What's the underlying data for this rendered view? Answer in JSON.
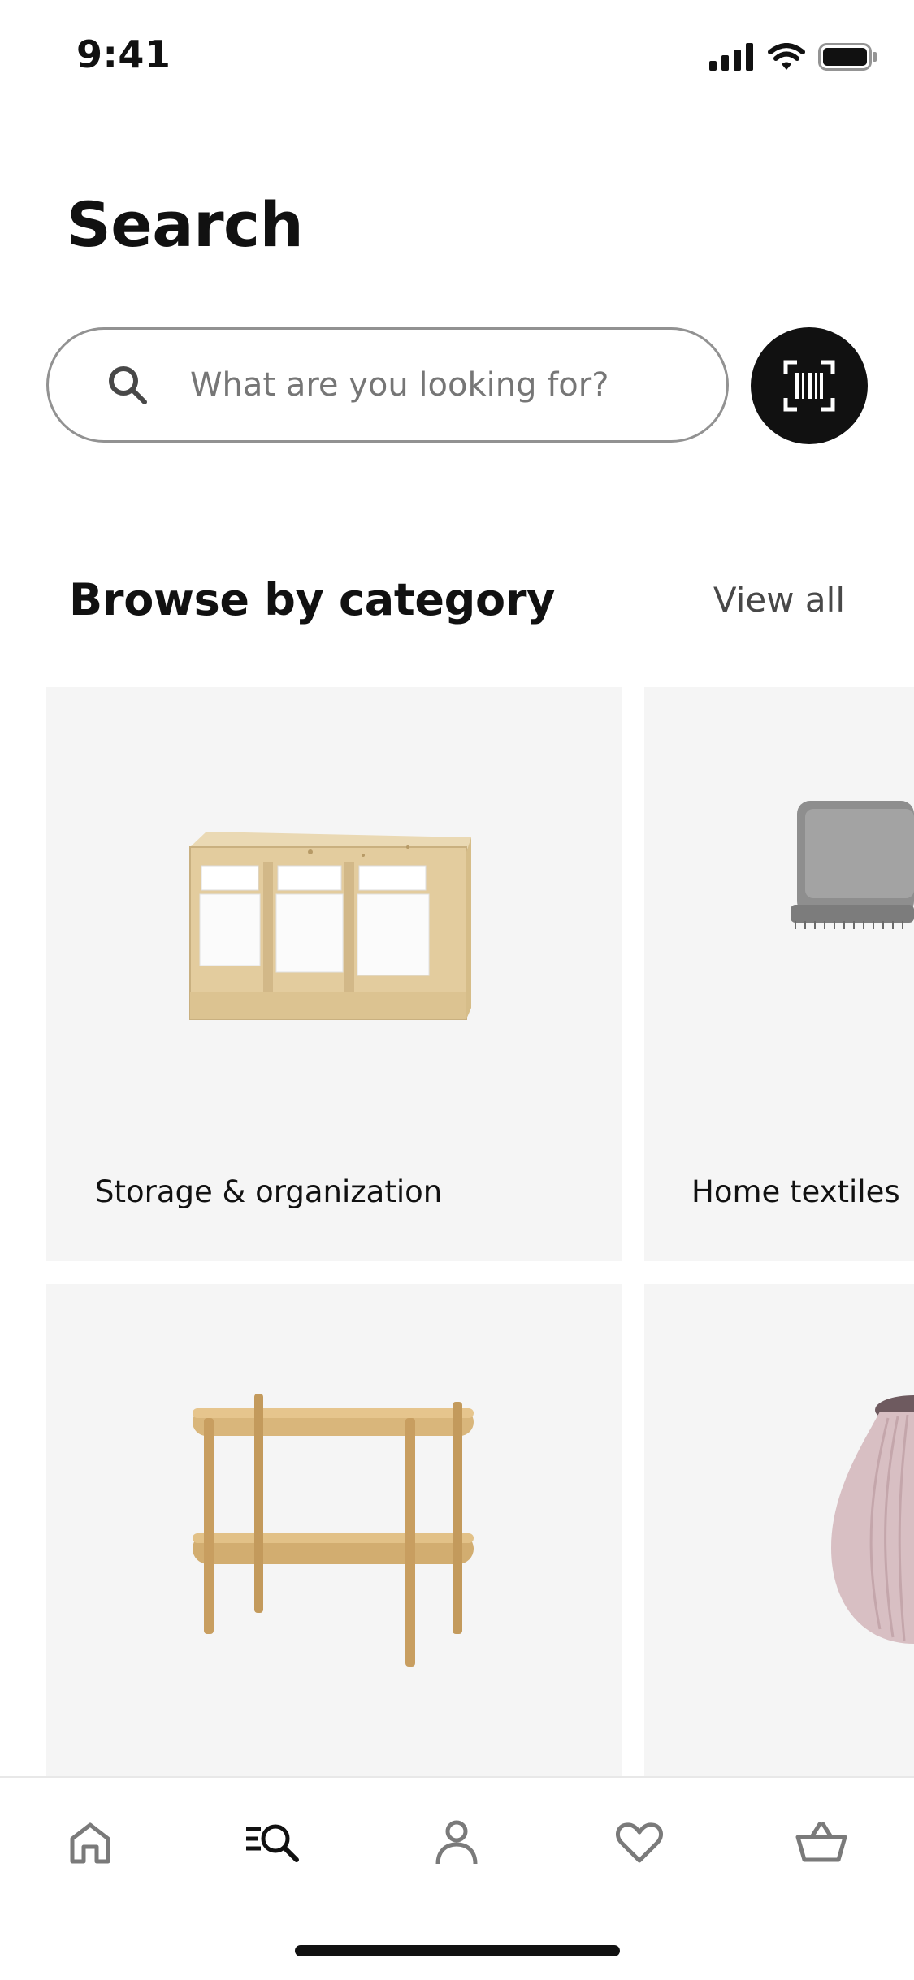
{
  "status_bar": {
    "time": "9:41"
  },
  "page": {
    "title": "Search"
  },
  "search": {
    "placeholder": "What are you looking for?"
  },
  "browse": {
    "title": "Browse by category",
    "view_all": "View all",
    "categories": [
      {
        "label": "Storage & organization",
        "image": "storage-shelf-image"
      },
      {
        "label": "Home textiles",
        "image": "grey-throw-image"
      },
      {
        "label": "",
        "image": "console-table-image"
      },
      {
        "label": "",
        "image": "pink-vase-image"
      }
    ]
  },
  "tabbar": {
    "items": [
      {
        "icon": "home-icon"
      },
      {
        "icon": "search-icon",
        "active": true
      },
      {
        "icon": "profile-icon"
      },
      {
        "icon": "heart-icon"
      },
      {
        "icon": "basket-icon"
      }
    ]
  },
  "colors": {
    "accent": "#111111",
    "card_bg": "#f5f5f5",
    "muted_text": "#767676"
  }
}
